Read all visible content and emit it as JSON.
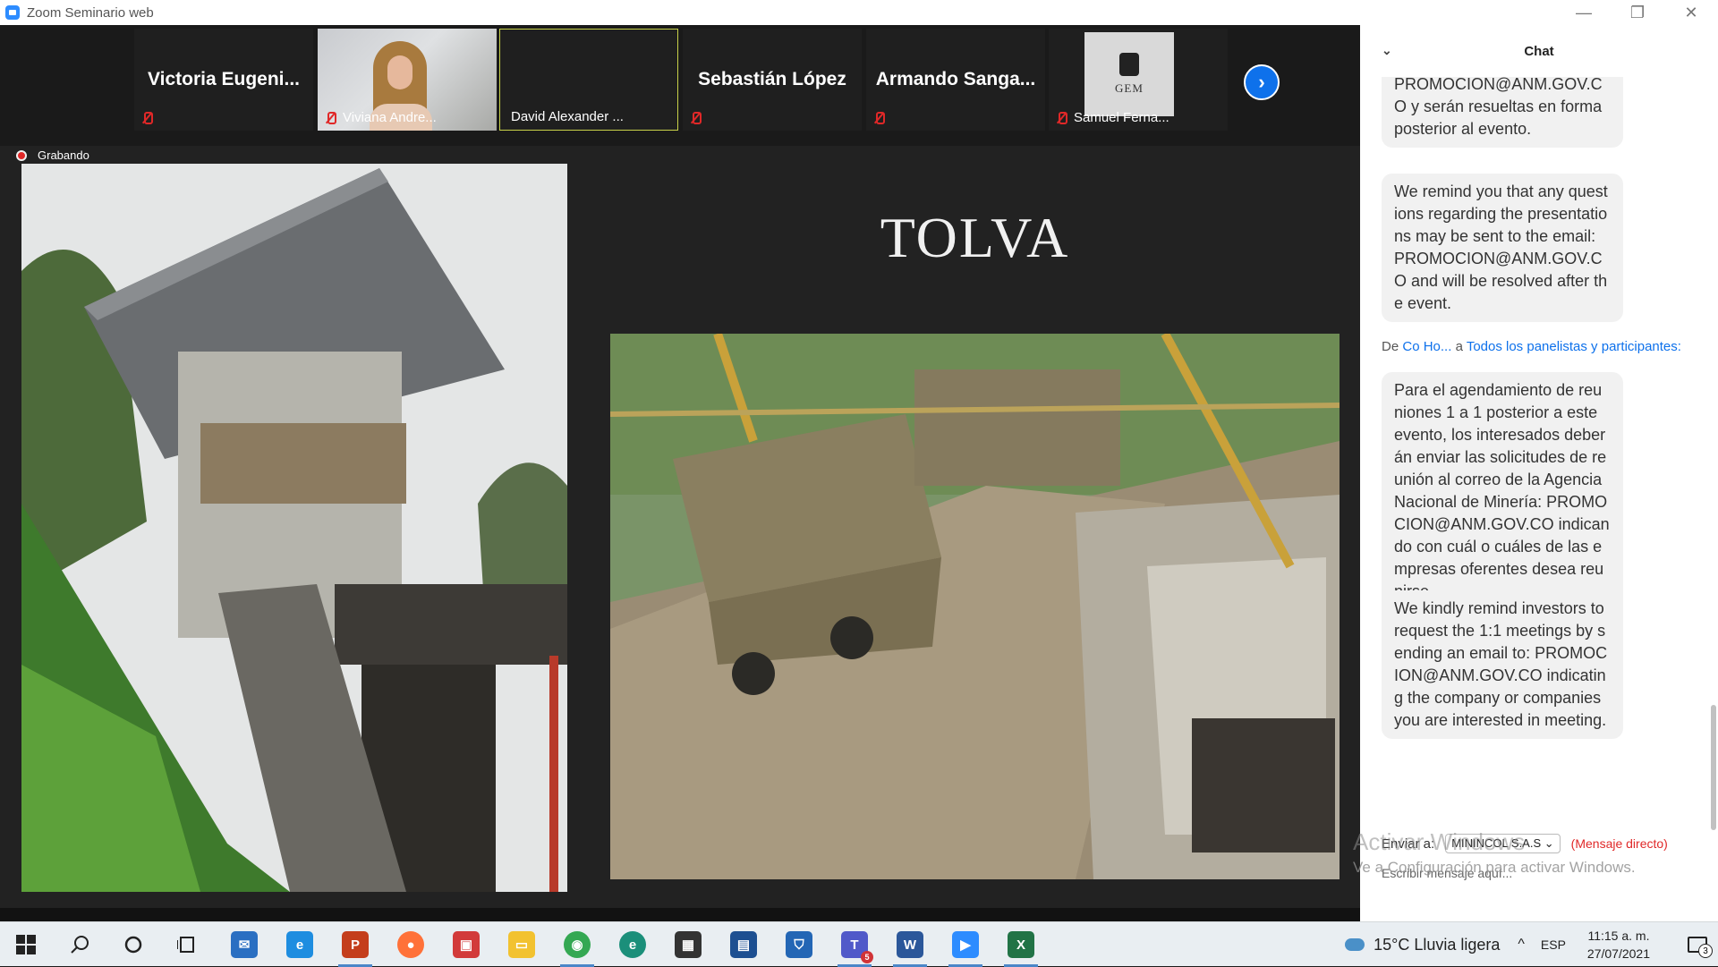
{
  "window": {
    "title": "Zoom Seminario web",
    "controls": [
      "—",
      "❐",
      "✕"
    ]
  },
  "gallery": {
    "tiles": [
      {
        "label": "Victoria  Eugeni...",
        "muted": true,
        "has_video": false
      },
      {
        "label": "Viviana Andre...",
        "muted": true,
        "has_video": true
      },
      {
        "label": "David Alexander ...",
        "muted": false,
        "has_video": false,
        "selected": true
      },
      {
        "label": "Sebastián López",
        "muted": true,
        "has_video": false
      },
      {
        "label": "Armando  Sanga...",
        "muted": true,
        "has_video": false
      },
      {
        "label": "Samuel Ferna...",
        "muted": true,
        "has_video": false,
        "logo_text": "GEM"
      }
    ],
    "next_icon": "chevron-right-icon"
  },
  "recording": {
    "label": "Grabando"
  },
  "slide": {
    "title": "TOLVA"
  },
  "chat": {
    "header": "Chat",
    "messages": [
      {
        "text": "PROMOCION@ANM.GOV.CO y serán resueltas en forma posterior al evento."
      },
      {
        "text": "We remind you that any questions regarding the presentations may be sent to the email: PROMOCION@ANM.GOV.CO and will be resolved after the event."
      },
      {
        "sender_prefix": "De",
        "sender": "Co Ho...",
        "to_prefix": "a",
        "to": "Todos los panelistas y participantes:"
      },
      {
        "text": "Para el agendamiento de reuniones 1 a 1 posterior a este evento, los interesados deberán enviar las solicitudes de reunión al correo de la Agencia Nacional de Minería: PROMOCION@ANM.GOV.CO indicando con cuál o cuáles de las empresas oferentes desea reunirse."
      },
      {
        "text": "We kindly remind investors to request the 1:1 meetings by sending an email to: PROMOCION@ANM.GOV.CO indicating the company or companies you are interested in meeting."
      }
    ],
    "send_to_label": "Enviar a:",
    "send_to_value": "MININCOL S.A.S",
    "direct_message": "(Mensaje directo)",
    "compose_placeholder": "Escribir mensaje aquí...",
    "watermark_line1": "Activar Windows",
    "watermark_line2": "Ve a Configuración para activar Windows."
  },
  "taskbar": {
    "weather": "15°C  Lluvia ligera",
    "lang": "ESP",
    "time": "11:15 a. m.",
    "date": "27/07/2021",
    "notifications_count": "3",
    "apps": [
      {
        "name": "windows-start-icon"
      },
      {
        "name": "search-icon"
      },
      {
        "name": "cortana-icon"
      },
      {
        "name": "task-view-icon"
      },
      {
        "name": "mail-icon",
        "color": "#2a6fc2"
      },
      {
        "name": "internet-explorer-icon",
        "color": "#1e8de0"
      },
      {
        "name": "powerpoint-icon",
        "color": "#c43e1c"
      },
      {
        "name": "firefox-icon",
        "color": "#ff7139"
      },
      {
        "name": "gift-icon",
        "color": "#d23a3a"
      },
      {
        "name": "file-explorer-icon",
        "color": "#f2c230"
      },
      {
        "name": "chrome-icon",
        "color": "#34a853"
      },
      {
        "name": "edge-icon",
        "color": "#1b8f7a"
      },
      {
        "name": "store-icon",
        "color": "#333333"
      },
      {
        "name": "connect-icon",
        "color": "#1d4f91"
      },
      {
        "name": "defender-icon",
        "color": "#2366b5"
      },
      {
        "name": "teams-icon",
        "color": "#5059c9",
        "badge": "5"
      },
      {
        "name": "word-icon",
        "color": "#2b579a"
      },
      {
        "name": "zoom-icon",
        "color": "#2d8cff"
      },
      {
        "name": "excel-icon",
        "color": "#217346"
      }
    ]
  }
}
